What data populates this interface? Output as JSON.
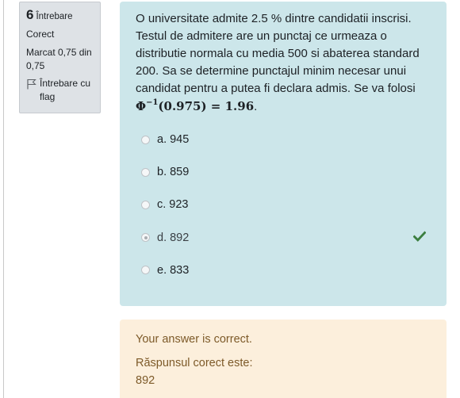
{
  "info": {
    "number": "6",
    "label": "Întrebare",
    "state": "Corect",
    "grade": "Marcat 0,75 din 0,75",
    "flag_label": "Întrebare cu flag"
  },
  "question": {
    "text": "O universitate admite 2.5 % dintre candidatii inscrisi. Testul de admitere are un punctaj ce urmeaza o distributie normala cu media 500 si abaterea standard 200. Sa se determine punctajul minim necesar unui candidat pentru a putea fi declara admis. Se va folosi",
    "math_base": "Φ",
    "math_exp": "−1",
    "math_rest": "(0.975) = 1.96",
    "math_end": "."
  },
  "options": [
    {
      "label": "a. 945"
    },
    {
      "label": "b. 859"
    },
    {
      "label": "c. 923"
    },
    {
      "label": "d. 892"
    },
    {
      "label": "e. 833"
    }
  ],
  "selected_index": 3,
  "colors": {
    "correct_check": "#3b7e3f",
    "formulation_bg": "#cce6ea",
    "outcome_bg": "#fcefdc",
    "outcome_text": "#7d5a29"
  },
  "outcome": {
    "feedback": "Your answer is correct.",
    "right_answer_label": "Răspunsul corect este:",
    "right_answer_value": "892"
  }
}
